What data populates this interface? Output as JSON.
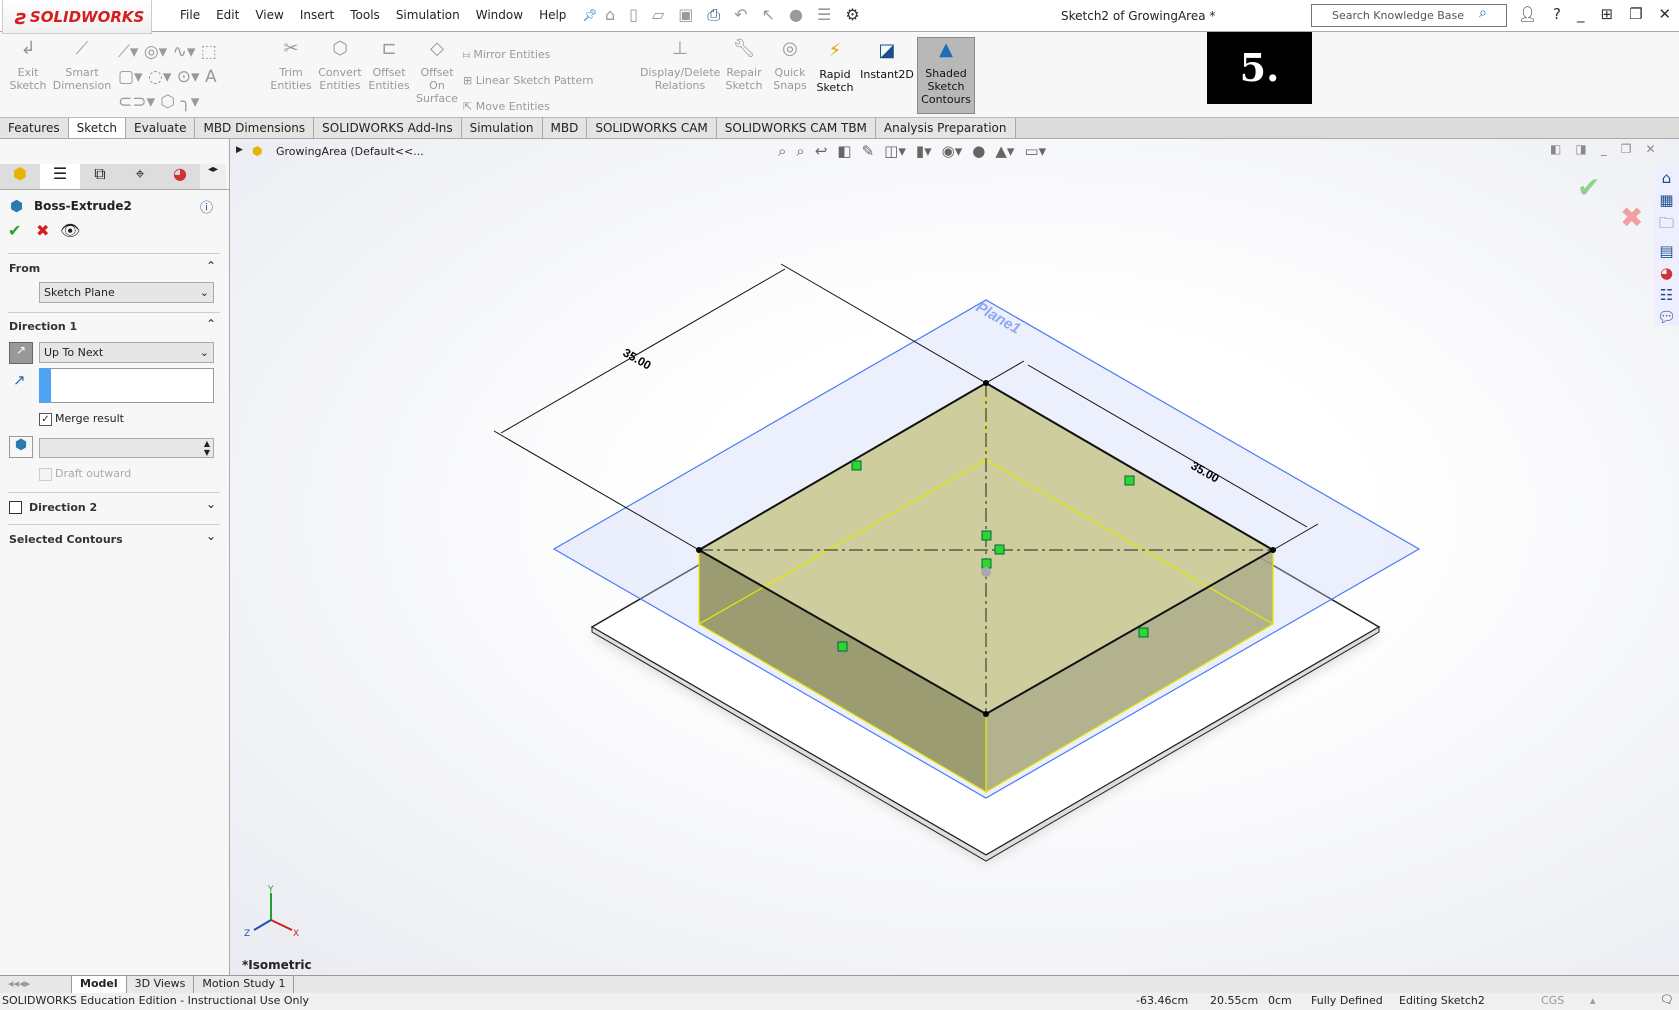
{
  "app": {
    "logo": "SOLIDWORKS",
    "doc_title": "Sketch2 of GrowingArea *",
    "step_badge": "5."
  },
  "menu": [
    "File",
    "Edit",
    "View",
    "Insert",
    "Tools",
    "Simulation",
    "Window",
    "Help"
  ],
  "search": {
    "placeholder": "Search Knowledge Base"
  },
  "ribbon": {
    "exit_sketch": "Exit Sketch",
    "smart_dimension": "Smart Dimension",
    "trim": "Trim Entities",
    "convert": "Convert Entities",
    "offset": "Offset Entities",
    "offset_surface": "Offset On Surface",
    "mirror": "Mirror Entities",
    "linear_pattern": "Linear Sketch Pattern",
    "move": "Move Entities",
    "display_relations": "Display/Delete Relations",
    "repair": "Repair Sketch",
    "quick_snaps": "Quick Snaps",
    "rapid": "Rapid Sketch",
    "instant2d": "Instant2D",
    "shaded": "Shaded Sketch Contours"
  },
  "tabs": [
    "Features",
    "Sketch",
    "Evaluate",
    "MBD Dimensions",
    "SOLIDWORKS Add-Ins",
    "Simulation",
    "MBD",
    "SOLIDWORKS CAM",
    "SOLIDWORKS CAM TBM",
    "Analysis Preparation"
  ],
  "active_tab": "Sketch",
  "property_manager": {
    "title": "Boss-Extrude2",
    "from_label": "From",
    "from_value": "Sketch Plane",
    "dir1_label": "Direction 1",
    "dir1_value": "Up To Next",
    "merge_label": "Merge result",
    "merge_checked": true,
    "draft_label": "Draft outward",
    "dir2_label": "Direction 2",
    "contours_label": "Selected Contours"
  },
  "tree": {
    "root": "GrowingArea  (Default<<..."
  },
  "viewport": {
    "dim1": "35.00",
    "dim2": "35.00",
    "plane_label": "Plane1",
    "view_name": "*Isometric",
    "triad": {
      "x": "X",
      "y": "Y",
      "z": "Z"
    }
  },
  "bottom_tabs": [
    "Model",
    "3D Views",
    "Motion Study 1"
  ],
  "status": {
    "edition": "SOLIDWORKS Education Edition - Instructional Use Only",
    "x": "-63.46cm",
    "y": "20.55cm",
    "z": "0cm",
    "state": "Fully Defined",
    "mode": "Editing Sketch2",
    "units": "CGS"
  },
  "colors": {
    "accent": "#d21f1f",
    "plane": "#4a7cf5",
    "face": "#c8c89a",
    "ok": "#2e9e2e",
    "cancel": "#d21f1f"
  }
}
